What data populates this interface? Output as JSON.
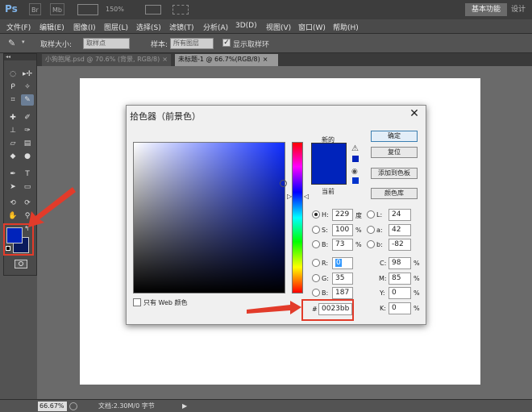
{
  "app": {
    "logo": "Ps",
    "appbar_items": [
      "Br",
      "Mb",
      "150%",
      "▾"
    ],
    "workspace_active": "基本功能",
    "workspace_other": "设计"
  },
  "menubar": [
    "文件(F)",
    "编辑(E)",
    "图像(I)",
    "图层(L)",
    "选择(S)",
    "滤镜(T)",
    "分析(A)",
    "3D(D)",
    "视图(V)",
    "窗口(W)",
    "帮助(H)"
  ],
  "options": {
    "sample_size_label": "取样大小:",
    "sample_size_value": "取样点",
    "sample_label": "样本:",
    "sample_value": "所有图层",
    "show_ring_label": "显示取样环",
    "show_ring_checked": true
  },
  "tabs": [
    {
      "label": "小狗抱尾.psd @ 70.6% (背景, RGB/8)",
      "close": "×",
      "active": false
    },
    {
      "label": "未标题-1 @ 66.7%(RGB/8)",
      "close": "×",
      "active": true
    }
  ],
  "toolbar": {
    "collapse": "◂◂",
    "foreground_color": "#0023bb",
    "background_color": "#0a1a5c"
  },
  "statusbar": {
    "zoom": "66.67%",
    "doc_info": "文档:2.30M/0 字节",
    "arrow": "▶"
  },
  "dialog": {
    "title": "拾色器（前景色）",
    "close": "✕",
    "new_label": "新的",
    "current_label": "当前",
    "new_color": "#0023bb",
    "current_color": "#0023bb",
    "buttons": {
      "ok": "确定",
      "reset": "复位",
      "add_swatch": "添加到色板",
      "color_library": "颜色库"
    },
    "hsb": {
      "h_label": "H:",
      "h_value": "229",
      "h_unit": "度",
      "s_label": "S:",
      "s_value": "100",
      "s_unit": "%",
      "b_label": "B:",
      "b_value": "73",
      "b_unit": "%"
    },
    "rgb": {
      "r_label": "R:",
      "r_value": "0",
      "g_label": "G:",
      "g_value": "35",
      "b_label": "B:",
      "b_value": "187"
    },
    "lab": {
      "l_label": "L:",
      "l_value": "24",
      "a_label": "a:",
      "a_value": "42",
      "b_label": "b:",
      "b_value": "-82"
    },
    "cmyk": {
      "c_label": "C:",
      "c_value": "98",
      "m_label": "M:",
      "m_value": "85",
      "y_label": "Y:",
      "y_value": "0",
      "k_label": "K:",
      "k_value": "0",
      "unit": "%"
    },
    "hex_label": "#",
    "hex_value": "0023bb",
    "web_only_label": "只有 Web 颜色",
    "selected_mode": "H"
  },
  "annotation_color": "#e23b2a"
}
